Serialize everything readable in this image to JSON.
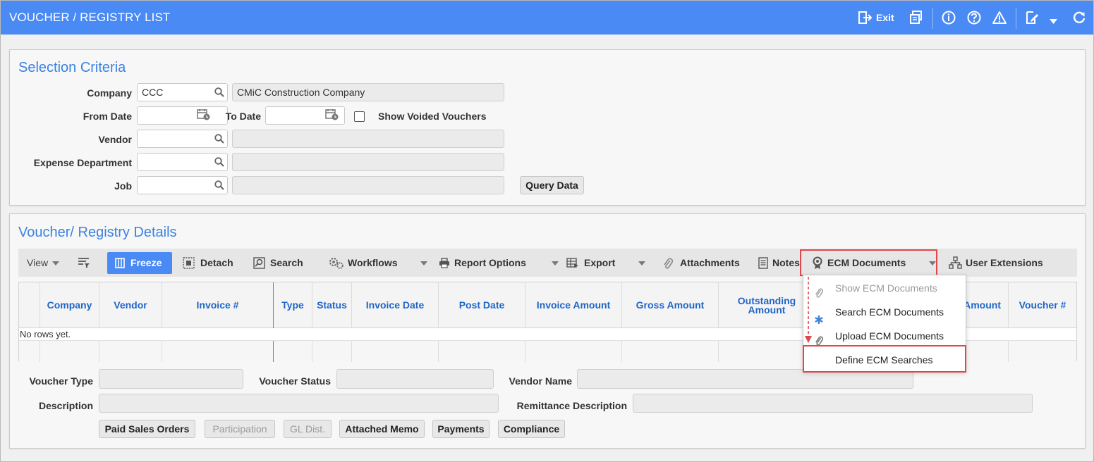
{
  "app": {
    "title": "VOUCHER / REGISTRY LIST",
    "exit_label": "Exit",
    "accent_color": "#4a8af4",
    "icons": [
      "exit-icon",
      "print-icon",
      "info-icon",
      "help-icon",
      "warning-icon",
      "edit-icon",
      "dropdown-icon",
      "refresh-icon"
    ]
  },
  "selection": {
    "title": "Selection Criteria",
    "company_label": "Company",
    "company_code": "CCC",
    "company_name": "CMiC Construction Company",
    "from_date_label": "From Date",
    "from_date_value": "",
    "to_date_label": "To Date",
    "to_date_value": "",
    "show_voided_label": "Show Voided Vouchers",
    "show_voided_checked": false,
    "vendor_label": "Vendor",
    "vendor_value": "",
    "vendor_name": "",
    "expense_dept_label": "Expense Department",
    "expense_dept_value": "",
    "expense_dept_name": "",
    "job_label": "Job",
    "job_value": "",
    "job_name": "",
    "query_button": "Query Data"
  },
  "details": {
    "title": "Voucher/ Registry Details",
    "toolbar": {
      "view": "View",
      "freeze": "Freeze",
      "detach": "Detach",
      "search": "Search",
      "workflows": "Workflows",
      "report_options": "Report Options",
      "export": "Export",
      "attachments": "Attachments",
      "notes": "Notes",
      "ecm_documents": "ECM Documents",
      "user_extensions": "User Extensions"
    },
    "columns": [
      "Company",
      "Vendor",
      "Invoice #",
      "Type",
      "Status",
      "Invoice Date",
      "Post Date",
      "Invoice Amount",
      "Gross Amount",
      "Outstanding Amount",
      "Amount",
      "Voucher #"
    ],
    "empty_text": "No rows yet.",
    "ecm_menu": [
      {
        "label": "Show ECM Documents",
        "icon": "paperclip-icon",
        "disabled": true
      },
      {
        "label": "Search ECM Documents",
        "icon": "asterisk-icon",
        "disabled": false
      },
      {
        "label": "Upload ECM Documents",
        "icon": "paperclip-icon",
        "disabled": false
      },
      {
        "label": "Define ECM Searches",
        "icon": "",
        "disabled": false
      }
    ],
    "form": {
      "voucher_type_label": "Voucher Type",
      "voucher_type_value": "",
      "voucher_status_label": "Voucher Status",
      "voucher_status_value": "",
      "vendor_name_label": "Vendor Name",
      "vendor_name_value": "",
      "description_label": "Description",
      "description_value": "",
      "remittance_label": "Remittance Description",
      "remittance_value": ""
    },
    "buttons": {
      "paid_sales_orders": "Paid Sales Orders",
      "participation": "Participation",
      "gl_dist": "GL Dist.",
      "attached_memo": "Attached Memo",
      "payments": "Payments",
      "compliance": "Compliance"
    },
    "highlight_color": "#e0474c"
  }
}
